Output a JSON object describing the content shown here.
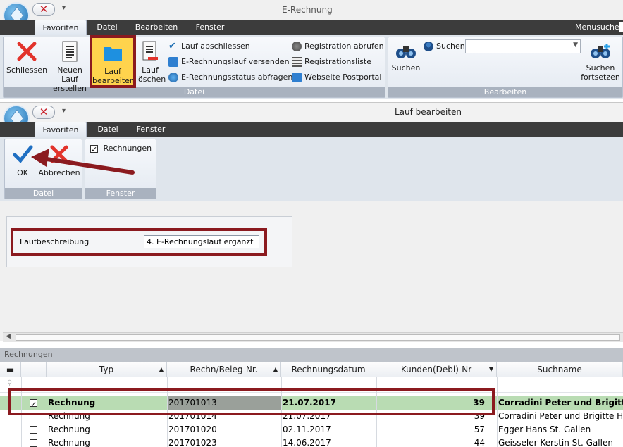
{
  "window1": {
    "title": "E-Rechnung",
    "menusuche": "Menusuche",
    "tabs": [
      {
        "label": "Favoriten"
      },
      {
        "label": "Datei"
      },
      {
        "label": "Bearbeiten"
      },
      {
        "label": "Fenster"
      }
    ],
    "buttons": {
      "schliessen": "Schliessen",
      "neuen_lauf": "Neuen Lauf erstellen",
      "lauf_bearbeiten": "Lauf bearbeiten",
      "lauf_loeschen": "Lauf löschen",
      "lauf_abschliessen": "Lauf abschliessen",
      "erechnungslauf_versenden": "E-Rechnungslauf versenden",
      "erechnungsstatus_abfragen": "E-Rechnungsstatus abfragen",
      "registration_abrufen": "Registration abrufen",
      "registrationsliste": "Registrationsliste",
      "webseite_postportal": "Webseite Postportal",
      "suchen_label": "Suchen",
      "suchen_big": "Suchen",
      "suchen_fortsetzen": "Suchen fortsetzen"
    },
    "groups": {
      "datei": "Datei",
      "bearbeiten": "Bearbeiten"
    }
  },
  "window2": {
    "title": "Lauf bearbeiten",
    "tabs": [
      {
        "label": "Favoriten"
      },
      {
        "label": "Datei"
      },
      {
        "label": "Fenster"
      }
    ],
    "buttons": {
      "ok": "OK",
      "abbrechen": "Abbrechen",
      "rechnungen": "Rechnungen"
    },
    "groups": {
      "datei": "Datei",
      "fenster": "Fenster"
    },
    "rechnungen_checked": true
  },
  "form": {
    "laufbeschreibung_label": "Laufbeschreibung",
    "laufbeschreibung_value": "4. E-Rechnungslauf ergänzt"
  },
  "grid": {
    "section_title": "Rechnungen",
    "columns": [
      "Typ",
      "Rechn/Beleg-Nr.",
      "Rechnungsdatum",
      "Kunden(Debi)-Nr",
      "Suchname"
    ],
    "rows": [
      {
        "checked": true,
        "typ": "Rechnung",
        "nr": "201701013",
        "datum": "21.07.2017",
        "kunde": "39",
        "suchname": "Corradini Peter und Brigitte H"
      },
      {
        "checked": false,
        "typ": "Rechnung",
        "nr": "201701014",
        "datum": "21.07.2017",
        "kunde": "39",
        "suchname": "Corradini Peter und Brigitte H"
      },
      {
        "checked": false,
        "typ": "Rechnung",
        "nr": "201701020",
        "datum": "02.11.2017",
        "kunde": "57",
        "suchname": "Egger Hans St. Gallen"
      },
      {
        "checked": false,
        "typ": "Rechnung",
        "nr": "201701023",
        "datum": "14.06.2017",
        "kunde": "44",
        "suchname": "Geisseler Kerstin St. Gallen"
      }
    ]
  },
  "colors": {
    "accent_red": "#8b1a1f",
    "ribbon_dark": "#3c3c3c",
    "selected_row": "#b9dcb3"
  }
}
